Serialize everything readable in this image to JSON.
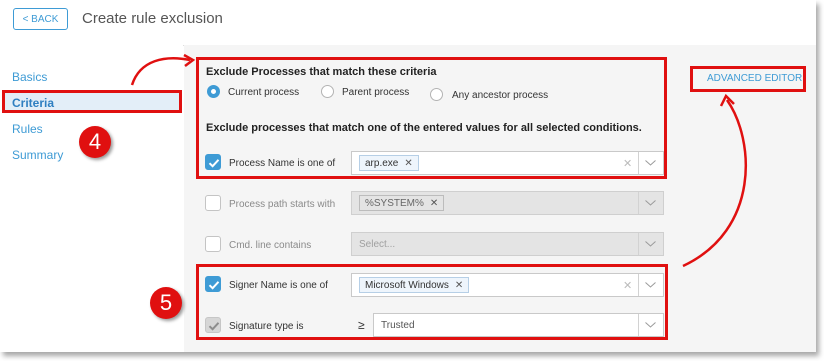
{
  "header": {
    "back_label": "< BACK",
    "title": "Create rule exclusion"
  },
  "sidebar": {
    "items": [
      {
        "label": "Basics",
        "active": false
      },
      {
        "label": "Criteria",
        "active": true
      },
      {
        "label": "Rules",
        "active": false
      },
      {
        "label": "Summary",
        "active": false
      }
    ]
  },
  "criteria": {
    "section_title": "Exclude Processes that match these criteria",
    "radios": [
      {
        "label": "Current process",
        "checked": true
      },
      {
        "label": "Parent process",
        "checked": false
      },
      {
        "label": "Any ancestor process",
        "checked": false
      }
    ],
    "subtitle": "Exclude processes that match one of the entered values for all selected conditions.",
    "advanced_editor": "ADVANCED EDITOR",
    "conditions": [
      {
        "label": "Process Name is one of",
        "checked": true,
        "disabled": false,
        "chip": "arp.exe"
      },
      {
        "label": "Process path starts with",
        "checked": false,
        "disabled": true,
        "chip": "%SYSTEM%"
      },
      {
        "label": "Cmd. line contains",
        "checked": false,
        "disabled": true,
        "placeholder": "Select..."
      },
      {
        "label": "Signer Name is one of",
        "checked": true,
        "disabled": false,
        "chip": "Microsoft Windows"
      },
      {
        "label": "Signature type is",
        "checked": true,
        "disabled": true,
        "operator": "≥",
        "value": "Trusted"
      }
    ]
  },
  "callouts": {
    "step4": "4",
    "step5": "5"
  },
  "colors": {
    "accent": "#3e9bd5",
    "annotation": "#e01010"
  },
  "icons": [
    "checkmark-icon",
    "close-icon",
    "chevron-down-icon"
  ]
}
